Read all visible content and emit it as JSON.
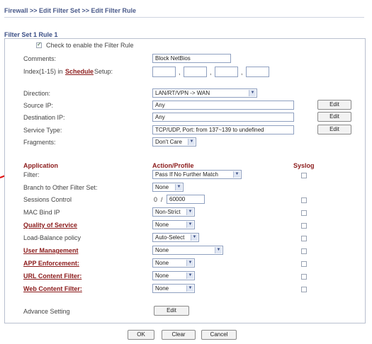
{
  "breadcrumb": "Firewall >> Edit Filter Set >> Edit Filter Rule",
  "section_title": "Filter Set 1 Rule 1",
  "enable_label": "Check to enable the Filter Rule",
  "comments": {
    "label": "Comments:",
    "value": "Block NetBios"
  },
  "schedule": {
    "label_prefix": "Index(1-15) in",
    "link": "Schedule",
    "label_suffix": "Setup:",
    "sep": ","
  },
  "direction": {
    "label": "Direction:",
    "value": "LAN/RT/VPN -> WAN"
  },
  "source_ip": {
    "label": "Source IP:",
    "value": "Any",
    "button": "Edit"
  },
  "dest_ip": {
    "label": "Destination IP:",
    "value": "Any",
    "button": "Edit"
  },
  "service": {
    "label": "Service Type:",
    "value": "TCP/UDP, Port: from 137~139 to undefined",
    "button": "Edit"
  },
  "fragments": {
    "label": "Fragments:",
    "value": "Don't Care"
  },
  "headers": {
    "application": "Application",
    "action": "Action/Profile",
    "syslog": "Syslog"
  },
  "rows": {
    "filter": {
      "label": "Filter:",
      "value": "Pass If No Further Match"
    },
    "branch": {
      "label": "Branch to Other Filter Set:",
      "value": "None"
    },
    "sessions": {
      "label": "Sessions Control",
      "current": "0",
      "slash": "/",
      "max": "60000"
    },
    "mac": {
      "label": "MAC Bind IP",
      "value": "Non-Strict"
    },
    "qos": {
      "label": "Quality of Service",
      "value": "None"
    },
    "lb": {
      "label": "Load-Balance policy",
      "value": "Auto-Select"
    },
    "user": {
      "label": "User Management",
      "value": "None"
    },
    "app": {
      "label": "APP Enforcement:",
      "value": "None"
    },
    "url": {
      "label": "URL Content Filter:",
      "value": "None"
    },
    "web": {
      "label": "Web Content Filter:",
      "value": "None"
    }
  },
  "advance": {
    "label": "Advance Setting",
    "button": "Edit"
  },
  "footer": {
    "ok": "OK",
    "clear": "Clear",
    "cancel": "Cancel"
  },
  "colors": {
    "accent": "#8b1a1a",
    "pointer": "#e01010",
    "title": "#3b4f86"
  }
}
